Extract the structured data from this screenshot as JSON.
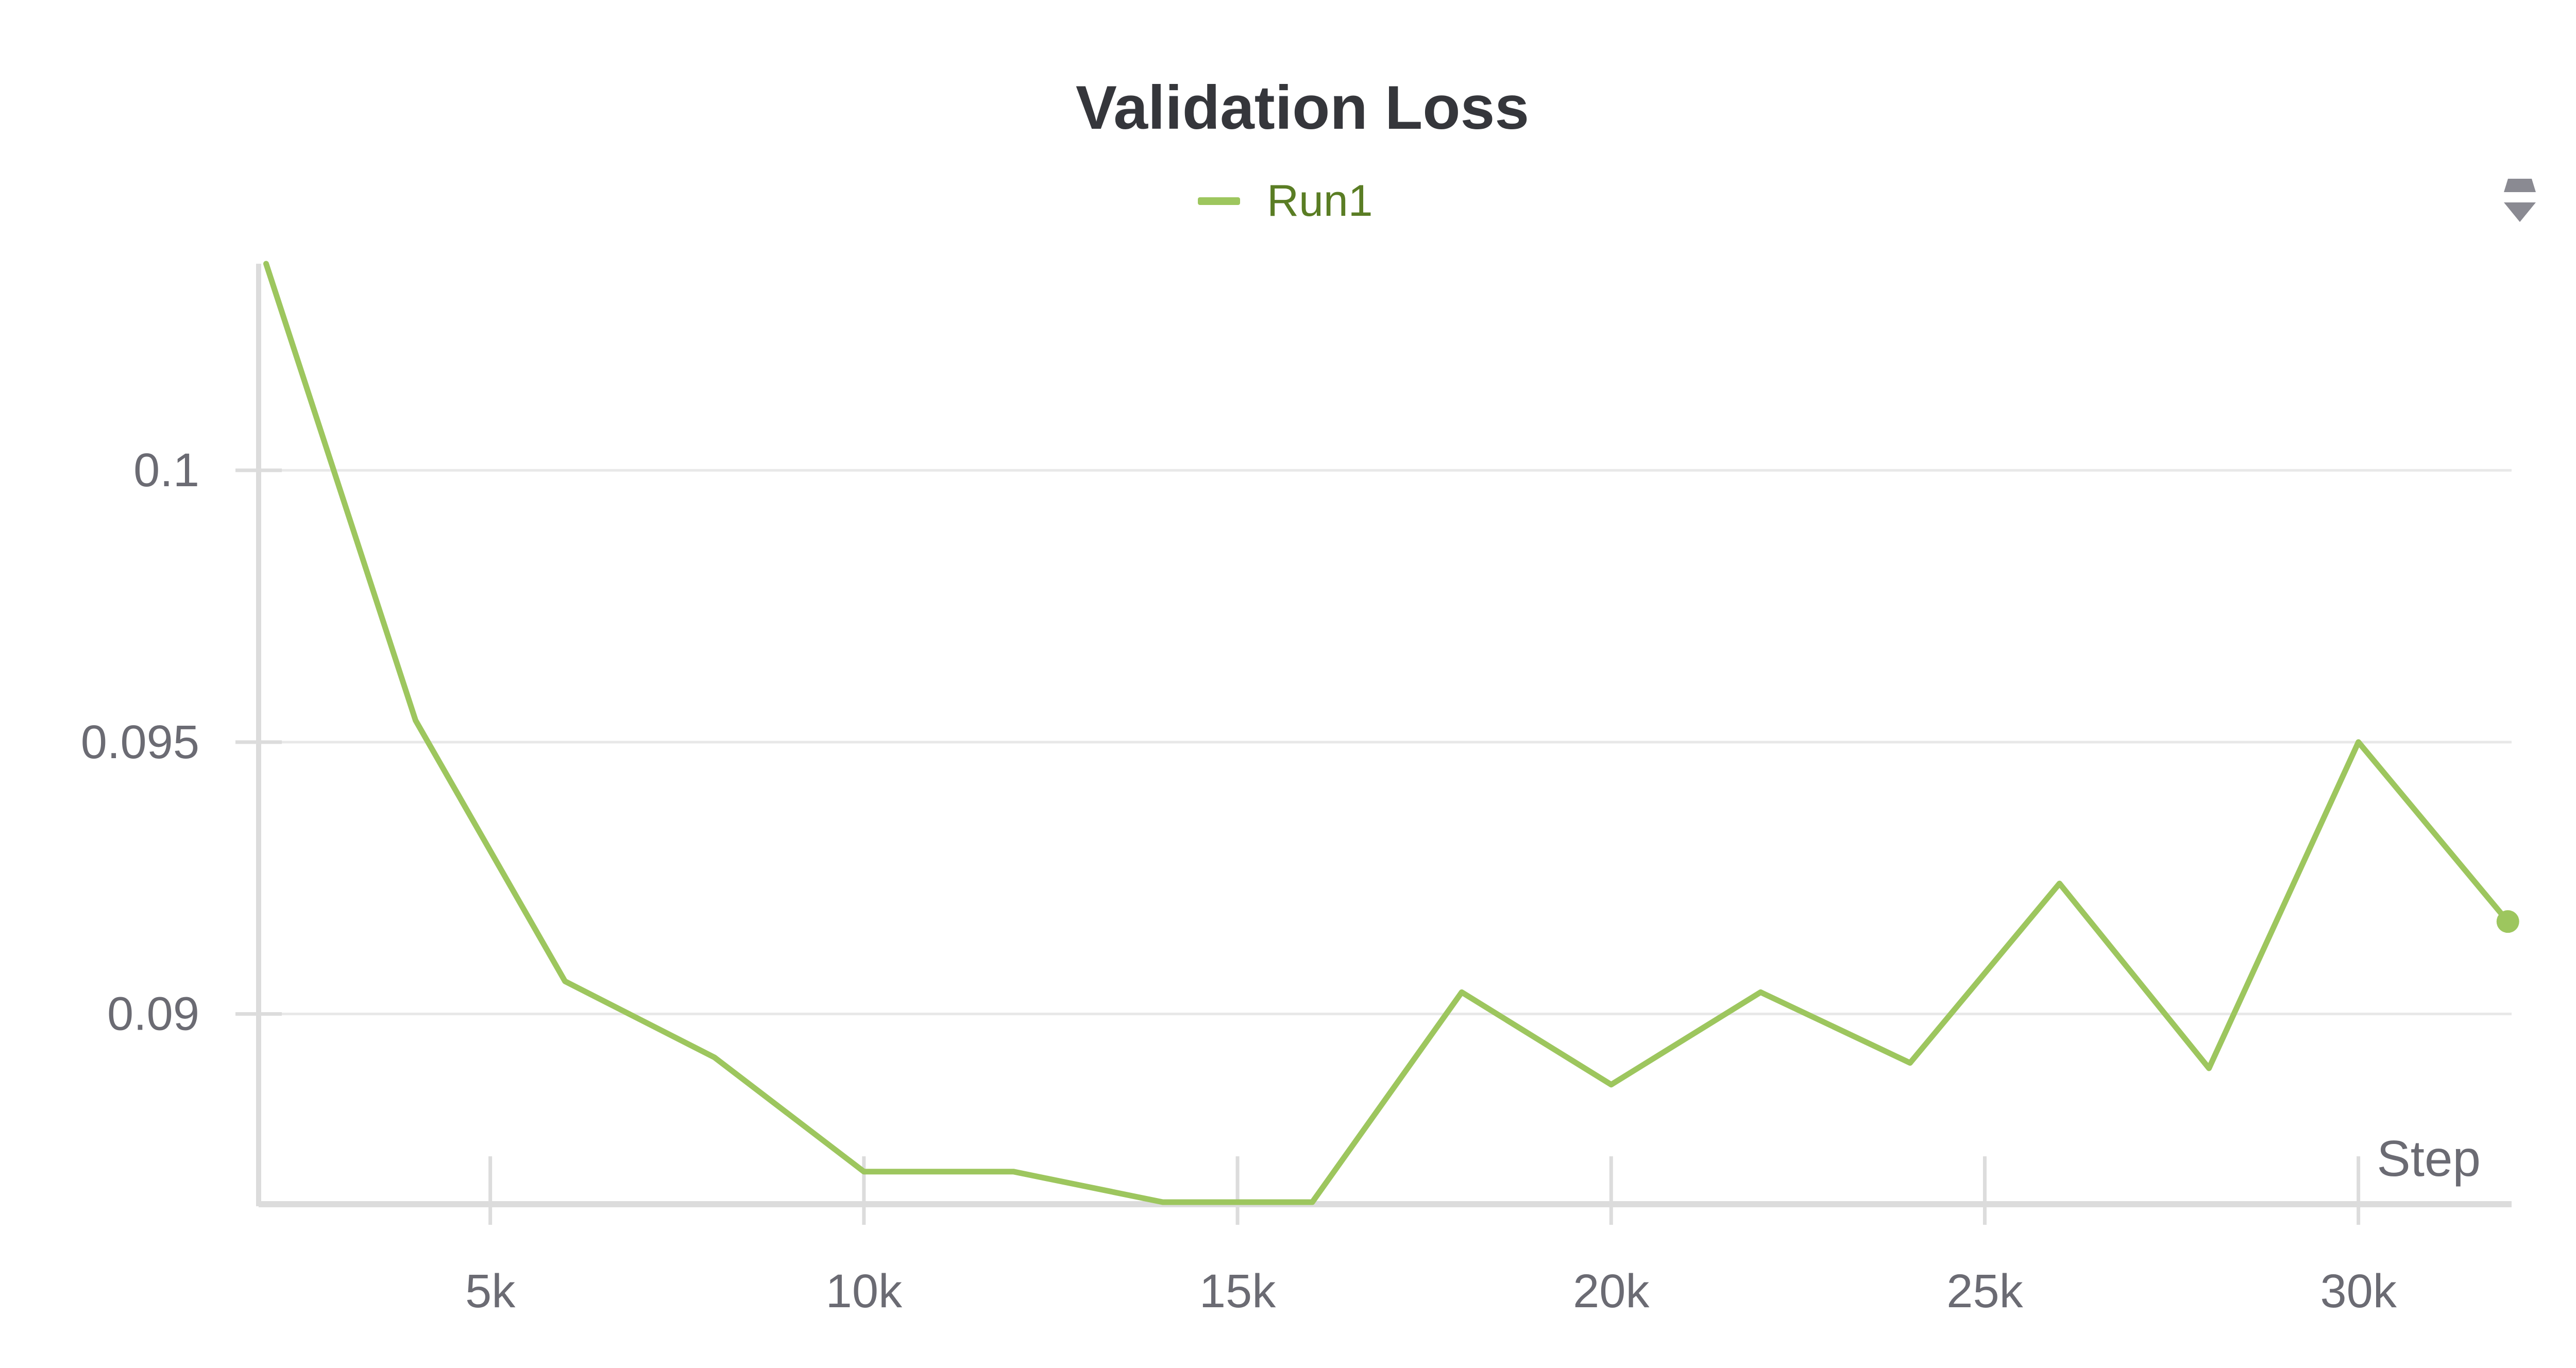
{
  "chart_data": {
    "type": "line",
    "title": "Validation Loss",
    "xlabel": "Step",
    "ylabel": "",
    "xlim": [
      1900,
      32050
    ],
    "ylim": [
      0.0865,
      0.1038
    ],
    "x_ticks": [
      5000,
      10000,
      15000,
      20000,
      25000,
      30000
    ],
    "x_tick_labels": [
      "5k",
      "10k",
      "15k",
      "20k",
      "25k",
      "30k"
    ],
    "y_ticks": [
      0.09,
      0.095,
      0.1
    ],
    "y_tick_labels": [
      "0.09",
      "0.095",
      "0.1"
    ],
    "grid": true,
    "legend_position": "top-center",
    "series": [
      {
        "name": "Run1",
        "color": "#9dc65e",
        "x": [
          2000,
          4000,
          6000,
          8000,
          10000,
          12000,
          14000,
          16000,
          18000,
          20000,
          22000,
          24000,
          26000,
          28000,
          30000,
          32000
        ],
        "y": [
          0.1038,
          0.0954,
          0.0906,
          0.0892,
          0.0871,
          0.0871,
          0.0865,
          0.0864,
          0.0904,
          0.0887,
          0.0904,
          0.0891,
          0.0924,
          0.089,
          0.095,
          0.0917
        ]
      }
    ]
  },
  "colors": {
    "title": "#35363b",
    "axis": "#dcdcdc",
    "grid": "#e8e8e8",
    "tick_label": "#6b6b73",
    "legend_label": "#5a7d24"
  },
  "icons": {
    "menu": "panel-menu-icon"
  }
}
